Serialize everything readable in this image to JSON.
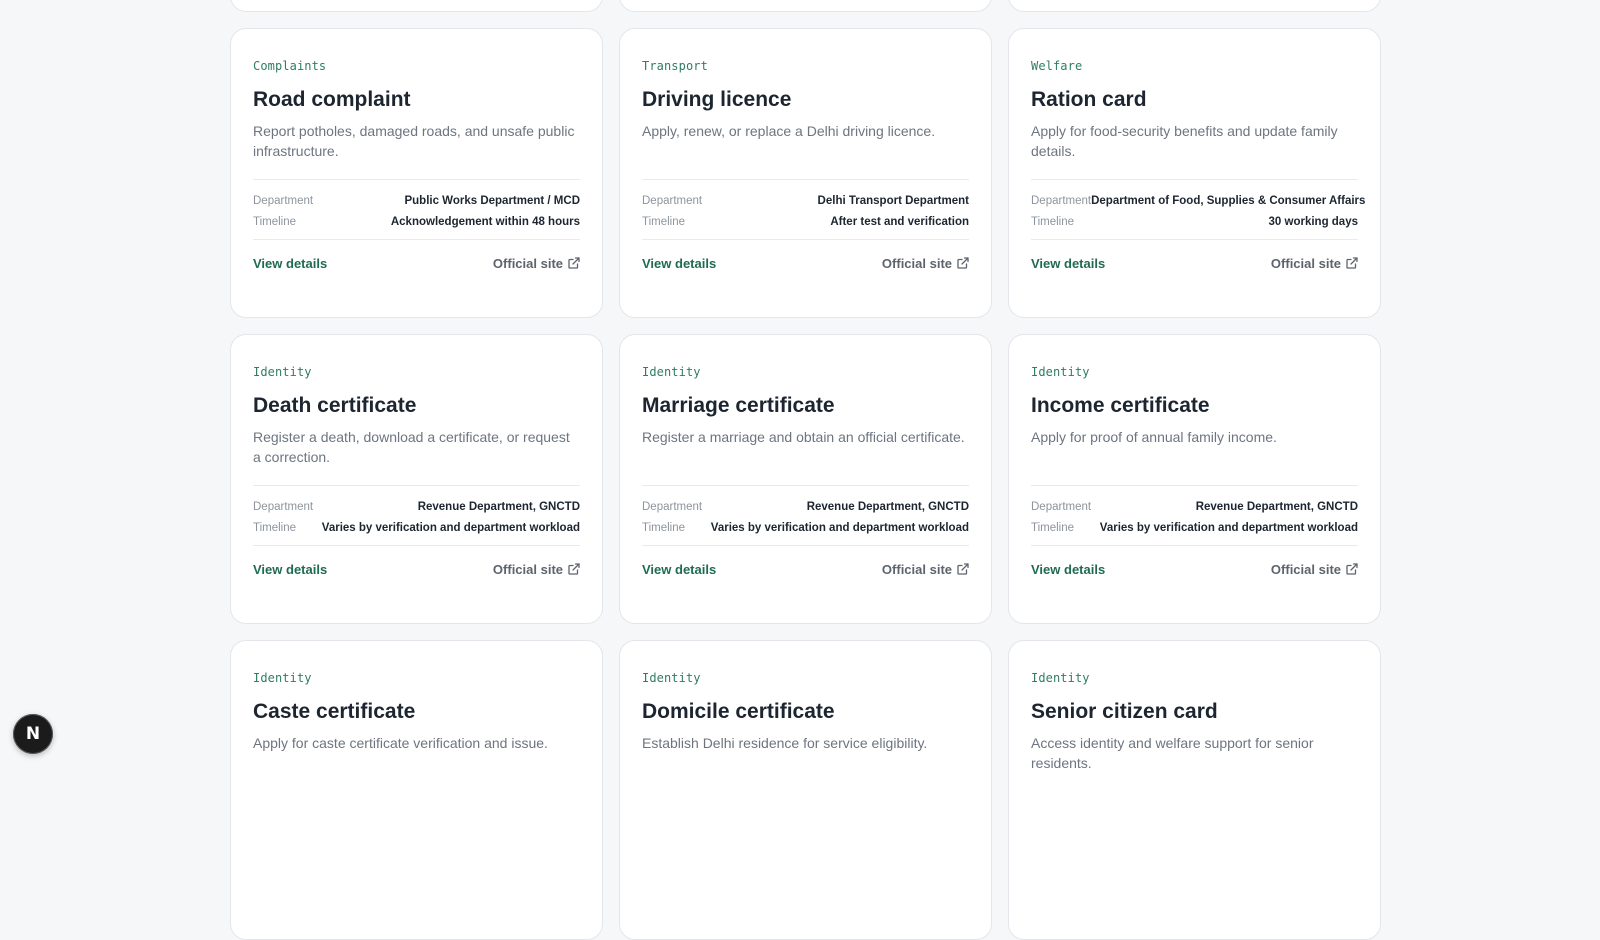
{
  "services": [
    {
      "category": "Complaints",
      "title": "Road complaint",
      "description": "Report potholes, damaged roads, and unsafe public infrastructure.",
      "department_label": "Department",
      "department": "Public Works Department / MCD",
      "timeline_label": "Timeline",
      "timeline": "Acknowledgement within 48 hours",
      "view_label": "View details",
      "official_label": "Official site"
    },
    {
      "category": "Transport",
      "title": "Driving licence",
      "description": "Apply, renew, or replace a Delhi driving licence.",
      "department_label": "Department",
      "department": "Delhi Transport Department",
      "timeline_label": "Timeline",
      "timeline": "After test and verification",
      "view_label": "View details",
      "official_label": "Official site"
    },
    {
      "category": "Welfare",
      "title": "Ration card",
      "description": "Apply for food-security benefits and update family details.",
      "department_label": "Department",
      "department": "Department of Food, Supplies & Consumer Affairs",
      "timeline_label": "Timeline",
      "timeline": "30 working days",
      "view_label": "View details",
      "official_label": "Official site"
    },
    {
      "category": "Identity",
      "title": "Death certificate",
      "description": "Register a death, download a certificate, or request a correction.",
      "department_label": "Department",
      "department": "Revenue Department, GNCTD",
      "timeline_label": "Timeline",
      "timeline": "Varies by verification and department workload",
      "view_label": "View details",
      "official_label": "Official site"
    },
    {
      "category": "Identity",
      "title": "Marriage certificate",
      "description": "Register a marriage and obtain an official certificate.",
      "department_label": "Department",
      "department": "Revenue Department, GNCTD",
      "timeline_label": "Timeline",
      "timeline": "Varies by verification and department workload",
      "view_label": "View details",
      "official_label": "Official site"
    },
    {
      "category": "Identity",
      "title": "Income certificate",
      "description": "Apply for proof of annual family income.",
      "department_label": "Department",
      "department": "Revenue Department, GNCTD",
      "timeline_label": "Timeline",
      "timeline": "Varies by verification and department workload",
      "view_label": "View details",
      "official_label": "Official site"
    },
    {
      "category": "Identity",
      "title": "Caste certificate",
      "description": "Apply for caste certificate verification and issue."
    },
    {
      "category": "Identity",
      "title": "Domicile certificate",
      "description": "Establish Delhi residence for service eligibility."
    },
    {
      "category": "Identity",
      "title": "Senior citizen card",
      "description": "Access identity and welfare support for senior residents."
    }
  ],
  "fab": {
    "letter": "N",
    "icon": "nextjs-logo-icon"
  },
  "colors": {
    "page_bg": "#f6f7f9",
    "card_bg": "#ffffff",
    "accent_green": "#1f6b52",
    "category_green": "#2f7d62",
    "heading": "#1c2530"
  }
}
